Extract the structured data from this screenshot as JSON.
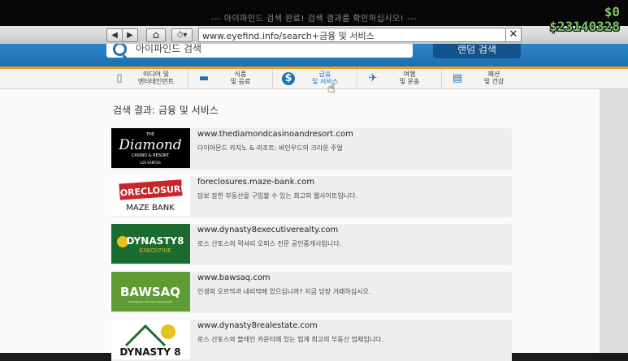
{
  "hud": {
    "notice": "--- 아이파인드 검색 완료! 검색 결과를 확인하십시오! ---",
    "cash": "$0",
    "bank": "$23140328",
    "cash_color": "#7fc46a"
  },
  "browser": {
    "back_icon": "◀",
    "forward_icon": "▶",
    "home_icon": "⌂",
    "history_icon": "⏱",
    "history_caret": "▾",
    "address": "www.eyefind.info/search+금융 및 서비스",
    "clear_icon": "✕"
  },
  "hero": {
    "query": "아이파인드 검색",
    "lucky_label": "랜덤 검색",
    "accent_color": "#e9a21f"
  },
  "categories": [
    {
      "icon": "▯",
      "label": "미디어 및\n엔터테인먼트"
    },
    {
      "icon": "▬",
      "label": "식품\n및 음료"
    },
    {
      "icon": "$",
      "label": "금융\n및 서비스"
    },
    {
      "icon": "✈",
      "label": "여행\n및 운송"
    },
    {
      "icon": "▤",
      "label": "패션\n및 건강"
    }
  ],
  "results_title": "검색 결과: 금융 및 서비스",
  "results": [
    {
      "url": "www.thediamondcasinoandresort.com",
      "desc": "다이아몬드 카지노 & 리조트: 바인우드의 크라운 주얼",
      "logo": {
        "line1": "THE",
        "line2": "Diamond",
        "line3": "CASINO & RESORT",
        "line4": "LOS SANTOS"
      }
    },
    {
      "url": "foreclosures.maze-bank.com",
      "desc": "담보 잡힌 부동산을 구입할 수 있는 최고의 웹사이트입니다.",
      "logo": {
        "line1": "FORECLOSURE",
        "line2": "MAZE BANK"
      }
    },
    {
      "url": "www.dynasty8executiverealty.com",
      "desc": "로스 산토스의 럭셔리 오피스 전문 공인중개사입니다.",
      "logo": {
        "line1": "DYNASTY8",
        "line2": "EXECUTIVE"
      }
    },
    {
      "url": "www.bawsaq.com",
      "desc": "인생의 오르막과 내리막에 있으십니까? 지금 당장 거래하십시오.",
      "logo": {
        "line1": "BAWSAQ",
        "line2": "DEALING IN LIFE'S UPS AND DOWNS"
      }
    },
    {
      "url": "www.dynasty8realestate.com",
      "desc": "로스 산토스와 블레인 카운티에 있는 업계 최고의 부동산 업체입니다.",
      "logo": {
        "line1": "DYNASTY 8"
      }
    }
  ]
}
